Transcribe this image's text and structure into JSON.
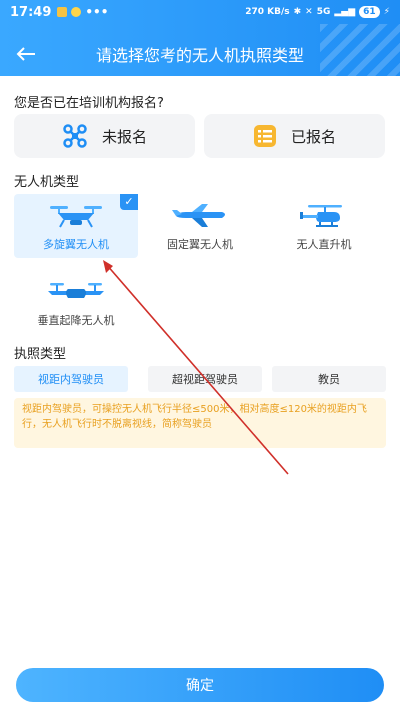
{
  "status_bar": {
    "time": "17:49",
    "net_speed": "270 KB/s",
    "network": "5G",
    "battery": "61"
  },
  "nav": {
    "title": "请选择您考的无人机执照类型"
  },
  "registration": {
    "question": "您是否已在培训机构报名?",
    "options": [
      {
        "label": "未报名",
        "icon": "drone-icon"
      },
      {
        "label": "已报名",
        "icon": "list-icon"
      }
    ]
  },
  "drone_types": {
    "label": "无人机类型",
    "items": [
      {
        "label": "多旋翼无人机",
        "icon": "multirotor-drone-icon",
        "selected": true
      },
      {
        "label": "固定翼无人机",
        "icon": "fixed-wing-plane-icon",
        "selected": false
      },
      {
        "label": "无人直升机",
        "icon": "helicopter-icon",
        "selected": false
      },
      {
        "label": "垂直起降无人机",
        "icon": "vtol-drone-icon",
        "selected": false
      }
    ],
    "check_mark": "✓"
  },
  "license_types": {
    "label": "执照类型",
    "tabs": [
      {
        "label": "视距内驾驶员",
        "active": true
      },
      {
        "label": "超视距驾驶员",
        "active": false
      },
      {
        "label": "教员",
        "active": false
      }
    ],
    "description": "视距内驾驶员，可操控无人机飞行半径≤500米，相对高度≤120米的视距内飞行，无人机飞行时不脱离视线，简称驾驶员"
  },
  "confirm_label": "确定",
  "colors": {
    "accent": "#1f8ef5",
    "selected_bg": "#e6f3ff",
    "notice_bg": "#fff6e0",
    "notice_text": "#e8a020",
    "annotation_arrow": "#d0302a"
  }
}
